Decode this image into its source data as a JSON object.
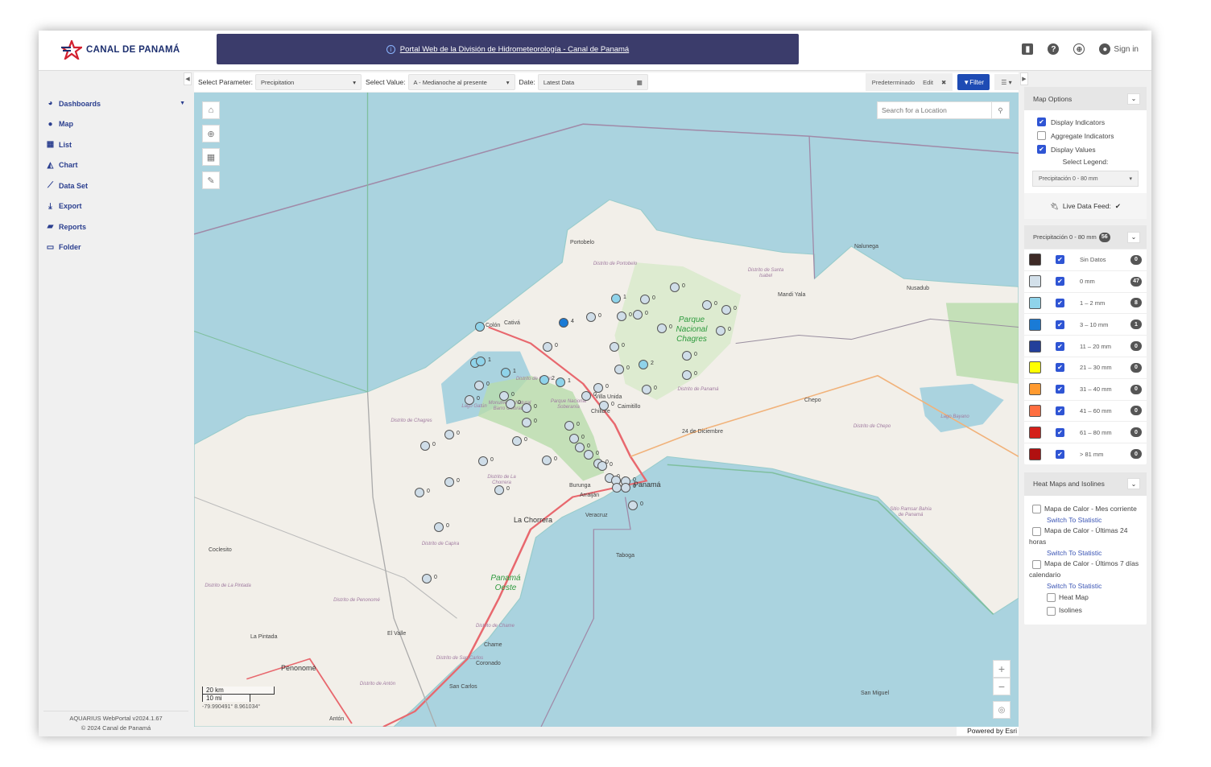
{
  "header": {
    "brand": "CANAL DE PANAMÁ",
    "banner_link": "Portal Web de la División de Hidrometeorología - Canal de Panamá",
    "sign_in": "Sign in",
    "icons": [
      "chart-icon",
      "help-icon",
      "globe-icon",
      "user-icon"
    ]
  },
  "sidebar": {
    "items": [
      {
        "label": "Dashboards",
        "icon": "dashboard-icon",
        "expandable": true
      },
      {
        "label": "Map",
        "icon": "globe-icon"
      },
      {
        "label": "List",
        "icon": "table-icon"
      },
      {
        "label": "Chart",
        "icon": "area-chart-icon"
      },
      {
        "label": "Data Set",
        "icon": "line-chart-icon"
      },
      {
        "label": "Export",
        "icon": "download-icon"
      },
      {
        "label": "Reports",
        "icon": "book-icon"
      },
      {
        "label": "Folder",
        "icon": "folder-icon"
      }
    ],
    "footer": {
      "version": "AQUARIUS WebPortal v2024.1.67",
      "copyright": "© 2024 Canal de Panamá"
    }
  },
  "toolbar": {
    "parameter_label": "Select Parameter:",
    "parameter_value": "Precipitation",
    "value_label": "Select Value:",
    "value_value": "A - Medianoche al presente",
    "date_label": "Date:",
    "date_value": "Latest Data",
    "preset": "Predeterminado",
    "edit": "Edit",
    "filter": "Filter"
  },
  "map": {
    "search_placeholder": "Search for a Location",
    "scale_km": "20 km",
    "scale_mi": "10 mi",
    "coords": "-79.990491° 8.961034°",
    "attribution": "Powered by Esri",
    "labels": {
      "portobelo": "Portobelo",
      "colon": "Colón",
      "cativa": "Cativá",
      "nalunega": "Nalunega",
      "nusadub": "Nusadub",
      "mandi": "Mandi Yala",
      "chepo": "Chepo",
      "diciembre": "24 de Diciembre",
      "panama": "Panamá",
      "burunga": "Burunga",
      "arraijan": "Arraiján",
      "veracruz": "Veracruz",
      "chorrera": "La Chorrera",
      "taboga": "Taboga",
      "coclesito": "Coclesito",
      "pintada": "La Pintada",
      "valle": "El Valle",
      "penonome": "Penonomé",
      "chame": "Chame",
      "coronado": "Coronado",
      "sancarlos": "San Carlos",
      "anton": "Antón",
      "sanmiguel": "San Miguel",
      "chilibre": "Chilibre",
      "caimitillo": "Caimitillo",
      "villa": "Villa Unida",
      "lago_bayano": "Lago Bayano",
      "lago_gatun": "Lago Gatún",
      "park_chagres": "Parque Nacional Chagres",
      "park_soberania": "Parque Nacional Soberanía",
      "barro": "Monumento Natural Barro Colorado",
      "ramsar": "Sitio Ramsar Bahía de Panamá",
      "panama_oeste": "Panamá Oeste",
      "d_portobelo": "Distrito de Portobelo",
      "d_santa_isabel": "Distrito de Santa Isabel",
      "d_colon": "Distrito de Colón",
      "d_panama": "Distrito de Panamá",
      "d_chagres": "Distrito de Chagres",
      "d_chorrera": "Distrito de La Chorrera",
      "d_capira": "Distrito de Capira",
      "d_chepo": "Distrito de Chepo",
      "d_pintada": "Distrito de La Pintada",
      "d_penonome": "Distrito de Penonomé",
      "d_chame": "Distrito de Chame",
      "d_sancarlos": "Distrito de San Carlos",
      "d_anton": "Distrito de Antón"
    },
    "station_values": [
      "0",
      "1",
      "0",
      "0",
      "0",
      "0",
      "0",
      "0",
      "4",
      "0",
      "0",
      "",
      "0",
      "0",
      "1",
      "1",
      "1",
      "2",
      "1",
      "2",
      "0",
      "0",
      "0",
      "0",
      "0",
      "0",
      "0",
      "0",
      "0",
      "0",
      "0",
      "0",
      "0",
      "0",
      "0",
      "0",
      "0",
      "0",
      "0",
      "0",
      "0",
      "0",
      "0",
      "0",
      "0",
      "0",
      "0",
      "0",
      "0",
      "0",
      "0",
      "0",
      "0",
      "0",
      "0"
    ],
    "station_colors": {
      "0 mm": "#cfdde8",
      "1 - 2 mm": "#8fd3ea",
      "3 - 10 mm": "#1a7bd6"
    }
  },
  "right_panel": {
    "map_options": {
      "title": "Map Options",
      "display_indicators": "Display Indicators",
      "display_indicators_checked": true,
      "aggregate_indicators": "Aggregate Indicators",
      "aggregate_indicators_checked": false,
      "display_values": "Display Values",
      "display_values_checked": true,
      "select_legend": "Select Legend:",
      "legend_value": "Precipitación 0 - 80 mm",
      "live_feed": "Live Data Feed:"
    },
    "legend": {
      "title": "Precipitación 0 - 80 mm",
      "total": "56",
      "items": [
        {
          "label": "Sin Datos",
          "count": "0",
          "color": "#3e2a26"
        },
        {
          "label": "0 mm",
          "count": "47",
          "color": "#d3e0ea"
        },
        {
          "label": "1 – 2 mm",
          "count": "8",
          "color": "#8fd3ea"
        },
        {
          "label": "3 – 10 mm",
          "count": "1",
          "color": "#1a7bd6"
        },
        {
          "label": "11 – 20 mm",
          "count": "0",
          "color": "#233f9a"
        },
        {
          "label": "21 – 30 mm",
          "count": "0",
          "color": "#ffff00"
        },
        {
          "label": "31 – 40 mm",
          "count": "0",
          "color": "#ff9a30"
        },
        {
          "label": "41 – 60 mm",
          "count": "0",
          "color": "#ff6e40"
        },
        {
          "label": "61 – 80 mm",
          "count": "0",
          "color": "#d4201a"
        },
        {
          "label": "> 81 mm",
          "count": "0",
          "color": "#b01010"
        }
      ]
    },
    "heatmaps": {
      "title": "Heat Maps and Isolines",
      "items": [
        {
          "label": "Mapa de Calor - Mes corriente",
          "link": "Switch To Statistic"
        },
        {
          "label": "Mapa de Calor - Últimas 24 horas",
          "link": "Switch To Statistic"
        },
        {
          "label": "Mapa de Calor - Últimos 7 días calendario",
          "link": "Switch To Statistic"
        }
      ],
      "heat_map": "Heat Map",
      "isolines": "Isolines"
    }
  }
}
